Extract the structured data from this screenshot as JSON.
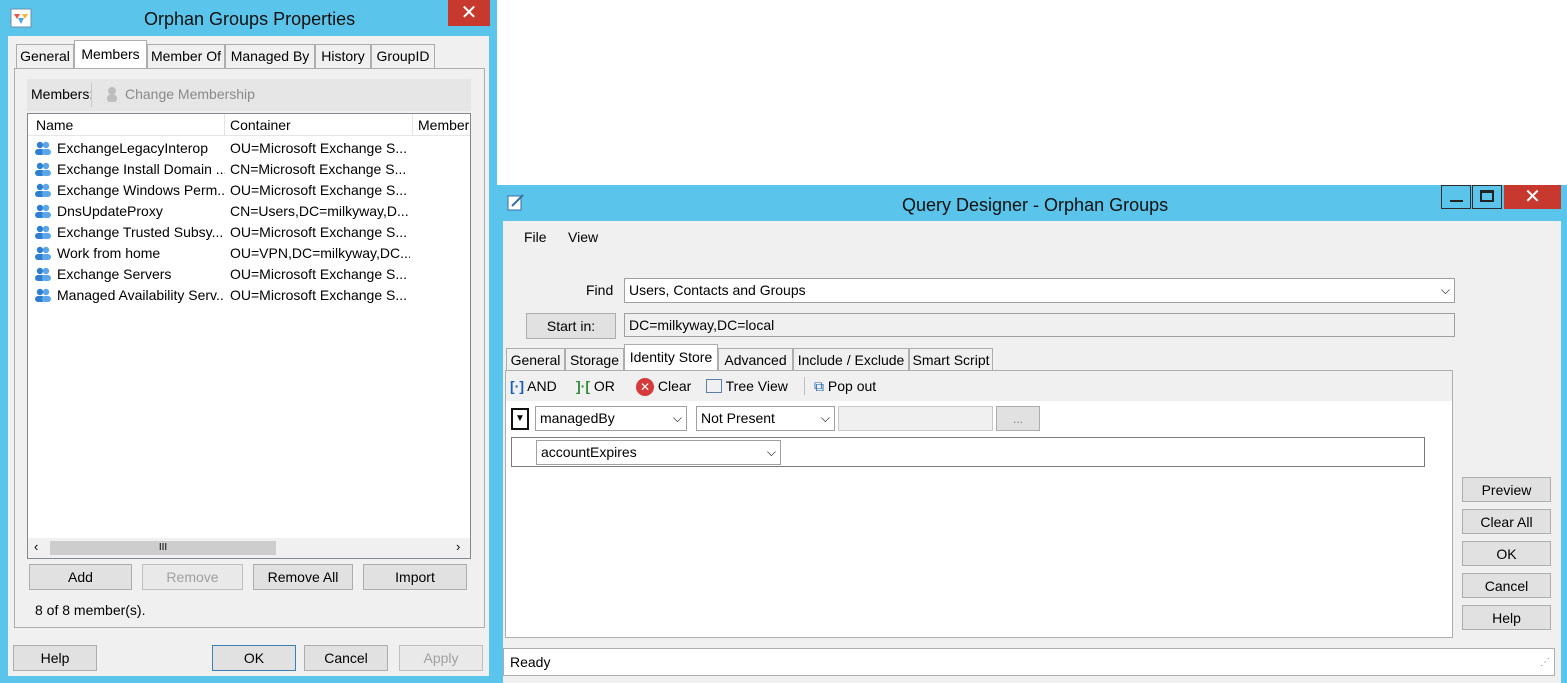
{
  "props": {
    "title": "Orphan Groups Properties",
    "tabs": [
      "General",
      "Members",
      "Member Of",
      "Managed By",
      "History",
      "GroupID"
    ],
    "members_label": "Members:",
    "change_membership": "Change Membership",
    "columns": [
      "Name",
      "Container",
      "Member"
    ],
    "members": [
      {
        "name": "ExchangeLegacyInterop",
        "container": "OU=Microsoft Exchange S..."
      },
      {
        "name": "Exchange Install Domain ...",
        "container": "CN=Microsoft Exchange S..."
      },
      {
        "name": "Exchange Windows Perm...",
        "container": "OU=Microsoft Exchange S..."
      },
      {
        "name": "DnsUpdateProxy",
        "container": "CN=Users,DC=milkyway,D..."
      },
      {
        "name": "Exchange Trusted Subsy...",
        "container": "OU=Microsoft Exchange S..."
      },
      {
        "name": "Work from home",
        "container": "OU=VPN,DC=milkyway,DC..."
      },
      {
        "name": "Exchange Servers",
        "container": "OU=Microsoft Exchange S..."
      },
      {
        "name": "Managed Availability Serv...",
        "container": "OU=Microsoft Exchange S..."
      }
    ],
    "buttons": {
      "add": "Add",
      "remove": "Remove",
      "remove_all": "Remove All",
      "import": "Import"
    },
    "count_text": "8 of 8 member(s).",
    "footer": {
      "help": "Help",
      "ok": "OK",
      "cancel": "Cancel",
      "apply": "Apply"
    },
    "scroll_thumb": "III"
  },
  "qd": {
    "title": "Query Designer - Orphan Groups",
    "menu": {
      "file": "File",
      "view": "View"
    },
    "find_label": "Find",
    "find_value": "Users, Contacts and Groups",
    "start_in_label": "Start in:",
    "start_in_value": "DC=milkyway,DC=local",
    "tabs": [
      "General",
      "Storage",
      "Identity Store",
      "Advanced",
      "Include / Exclude",
      "Smart Script"
    ],
    "toolbar": {
      "and": "AND",
      "or": "OR",
      "clear": "Clear",
      "tree_view": "Tree View",
      "pop_out": "Pop out"
    },
    "criteria": {
      "attribute": "managedBy",
      "operator": "Not Present",
      "ellipsis": "...",
      "second_attribute": "accountExpires"
    },
    "side_buttons": {
      "preview": "Preview",
      "clear_all": "Clear All",
      "ok": "OK",
      "cancel": "Cancel",
      "help": "Help"
    },
    "status": "Ready",
    "colors": {
      "frame": "#5bc4ea",
      "close": "#c7392f"
    }
  }
}
